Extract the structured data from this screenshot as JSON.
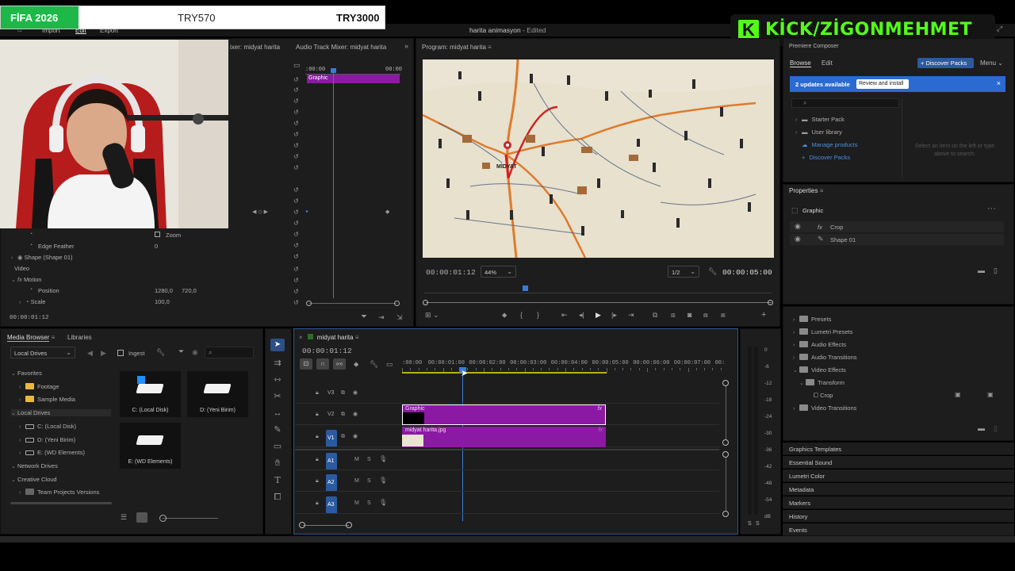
{
  "overlay": {
    "scoreboard": {
      "left": "FİFA 2026",
      "mid": "TRY570",
      "right": "TRY3000"
    },
    "brand": {
      "k_letter": "K",
      "text": "KİCK/ZİGONMEHMET"
    }
  },
  "menubar": {
    "import": "Import",
    "edit": "Edit",
    "export": "Export",
    "title": "harita animasyon",
    "edited": "- Edited"
  },
  "effect_controls": {
    "tabs": {
      "mixer": "ixer: midyat harita",
      "audio_mixer": "Audio Track Mixer: midyat harita"
    },
    "time_start": ":00:00",
    "time_end": "00:00",
    "clip_label": "Graphic",
    "zoom_label": "Zoom",
    "edge_feather": "Edge Feather",
    "edge_feather_value": "0",
    "shape_label": "Shape (Shape 01)",
    "video_label": "Video",
    "motion_label": "Motion",
    "position_label": "Position",
    "position_x": "1280,0",
    "position_y": "720,0",
    "scale_label": "Scale",
    "scale_value": "100,0",
    "timecode": "00:00:01:12"
  },
  "program": {
    "tab": "Program: midyat harita",
    "timecode": "00:00:01:12",
    "zoom": "44%",
    "quality": "1/2",
    "duration": "00:00:05:00",
    "map_label": "MİDYAT",
    "playhead_fraction": 0.29
  },
  "media_browser": {
    "tab1": "Media Browser",
    "tab2": "Libraries",
    "local_drives": "Local Drives",
    "ingest": "Ingest",
    "tree": [
      {
        "label": "Favorites",
        "level": 0
      },
      {
        "label": "Footage",
        "level": 1
      },
      {
        "label": "Sample Media",
        "level": 1
      },
      {
        "label": "Local Drives",
        "level": 0
      },
      {
        "label": "C: (Local Disk)",
        "level": 1
      },
      {
        "label": "D: (Yeni Birim)",
        "level": 1
      },
      {
        "label": "E: (WD Elements)",
        "level": 1
      },
      {
        "label": "Network Drives",
        "level": 0
      },
      {
        "label": "Creative Cloud",
        "level": 0
      },
      {
        "label": "Team Projects Versions",
        "level": 1
      }
    ],
    "drives": [
      {
        "label": "C: (Local Disk)",
        "icon": "windows-drive"
      },
      {
        "label": "D: (Yeni Birim)",
        "icon": "drive"
      },
      {
        "label": "E: (WD Elements)",
        "icon": "drive"
      }
    ]
  },
  "timeline": {
    "tab": "midyat harita",
    "timecode": "00:00:01:12",
    "ruler": ":00:00",
    "r1": "00:00:01:00",
    "r2": "00:00:02:00",
    "r3": "00:00:03:00",
    "r4": "00:00:04:00",
    "r5": "00:00:05:00",
    "r6": "00:00:06:00",
    "r7": "00:00:07:00",
    "r8": "00:",
    "tracks": [
      "V3",
      "V2",
      "V1",
      "A1",
      "A2",
      "A3"
    ],
    "clip_graphic": "Graphic",
    "clip_map": "midyat harita.jpg",
    "fx": "fx",
    "m": "M",
    "s": "S"
  },
  "meter": {
    "labels": [
      "0",
      "-6",
      "-12",
      "-18",
      "-24",
      "-30",
      "-36",
      "-42",
      "-48",
      "-54",
      "dB"
    ],
    "s1": "S",
    "s2": "S"
  },
  "essential": {
    "title": "Premiere Composer",
    "browse": "Browse",
    "edit": "Edit",
    "discover_btn": "+ Discover Packs",
    "menu": "Menu",
    "updates": "2 updates available",
    "review": "Review and install",
    "items": [
      "Starter Pack",
      "User library",
      "Manage products",
      "Discover Packs"
    ],
    "hint": "Select an item on the left or type above to search."
  },
  "properties": {
    "title": "Properties",
    "graphic": "Graphic",
    "crop": "Crop",
    "shape": "Shape 01",
    "fx": "fx"
  },
  "effects": {
    "items": [
      {
        "label": "Presets",
        "level": 0
      },
      {
        "label": "Lumetri Presets",
        "level": 0
      },
      {
        "label": "Audio Effects",
        "level": 0
      },
      {
        "label": "Audio Transitions",
        "level": 0
      },
      {
        "label": "Video Effects",
        "level": 0
      },
      {
        "label": "Transform",
        "level": 1
      },
      {
        "label": "Crop",
        "level": 2
      },
      {
        "label": "Video Transitions",
        "level": 0
      }
    ],
    "bottom": [
      "Graphics Templates",
      "Essential Sound",
      "Lumetri Color",
      "Metadata",
      "Markers",
      "History",
      "Events"
    ]
  }
}
